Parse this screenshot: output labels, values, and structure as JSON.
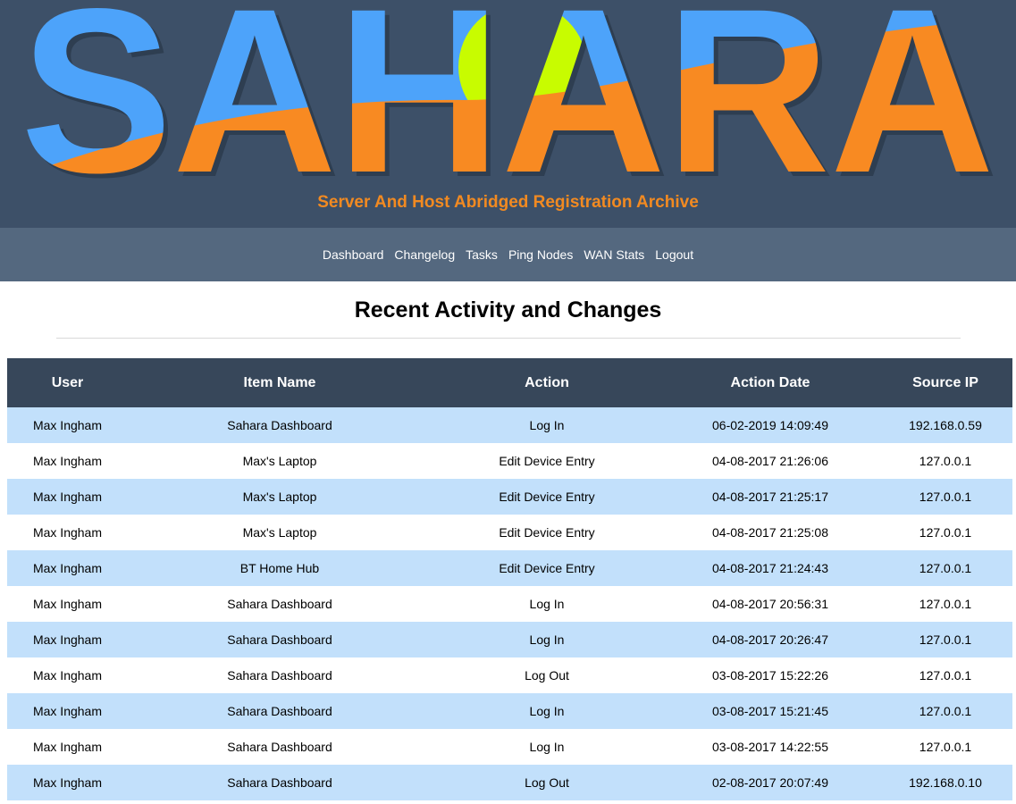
{
  "header": {
    "logo_text": "SAHARA",
    "tagline": "Server And Host Abridged Registration Archive",
    "colors": {
      "blue": "#4da3fa",
      "orange": "#f88a22",
      "lime": "#c8fc00",
      "background": "#3d5068"
    }
  },
  "nav": {
    "items": [
      {
        "label": "Dashboard"
      },
      {
        "label": "Changelog"
      },
      {
        "label": "Tasks"
      },
      {
        "label": "Ping Nodes"
      },
      {
        "label": "WAN Stats"
      },
      {
        "label": "Logout"
      }
    ]
  },
  "page": {
    "title": "Recent Activity and Changes"
  },
  "table": {
    "columns": [
      "User",
      "Item Name",
      "Action",
      "Action Date",
      "Source IP"
    ],
    "rows": [
      [
        "Max Ingham",
        "Sahara Dashboard",
        "Log In",
        "06-02-2019 14:09:49",
        "192.168.0.59"
      ],
      [
        "Max Ingham",
        "Max's Laptop",
        "Edit Device Entry",
        "04-08-2017 21:26:06",
        "127.0.0.1"
      ],
      [
        "Max Ingham",
        "Max's Laptop",
        "Edit Device Entry",
        "04-08-2017 21:25:17",
        "127.0.0.1"
      ],
      [
        "Max Ingham",
        "Max's Laptop",
        "Edit Device Entry",
        "04-08-2017 21:25:08",
        "127.0.0.1"
      ],
      [
        "Max Ingham",
        "BT Home Hub",
        "Edit Device Entry",
        "04-08-2017 21:24:43",
        "127.0.0.1"
      ],
      [
        "Max Ingham",
        "Sahara Dashboard",
        "Log In",
        "04-08-2017 20:56:31",
        "127.0.0.1"
      ],
      [
        "Max Ingham",
        "Sahara Dashboard",
        "Log In",
        "04-08-2017 20:26:47",
        "127.0.0.1"
      ],
      [
        "Max Ingham",
        "Sahara Dashboard",
        "Log Out",
        "03-08-2017 15:22:26",
        "127.0.0.1"
      ],
      [
        "Max Ingham",
        "Sahara Dashboard",
        "Log In",
        "03-08-2017 15:21:45",
        "127.0.0.1"
      ],
      [
        "Max Ingham",
        "Sahara Dashboard",
        "Log In",
        "03-08-2017 14:22:55",
        "127.0.0.1"
      ],
      [
        "Max Ingham",
        "Sahara Dashboard",
        "Log Out",
        "02-08-2017 20:07:49",
        "192.168.0.10"
      ]
    ]
  }
}
